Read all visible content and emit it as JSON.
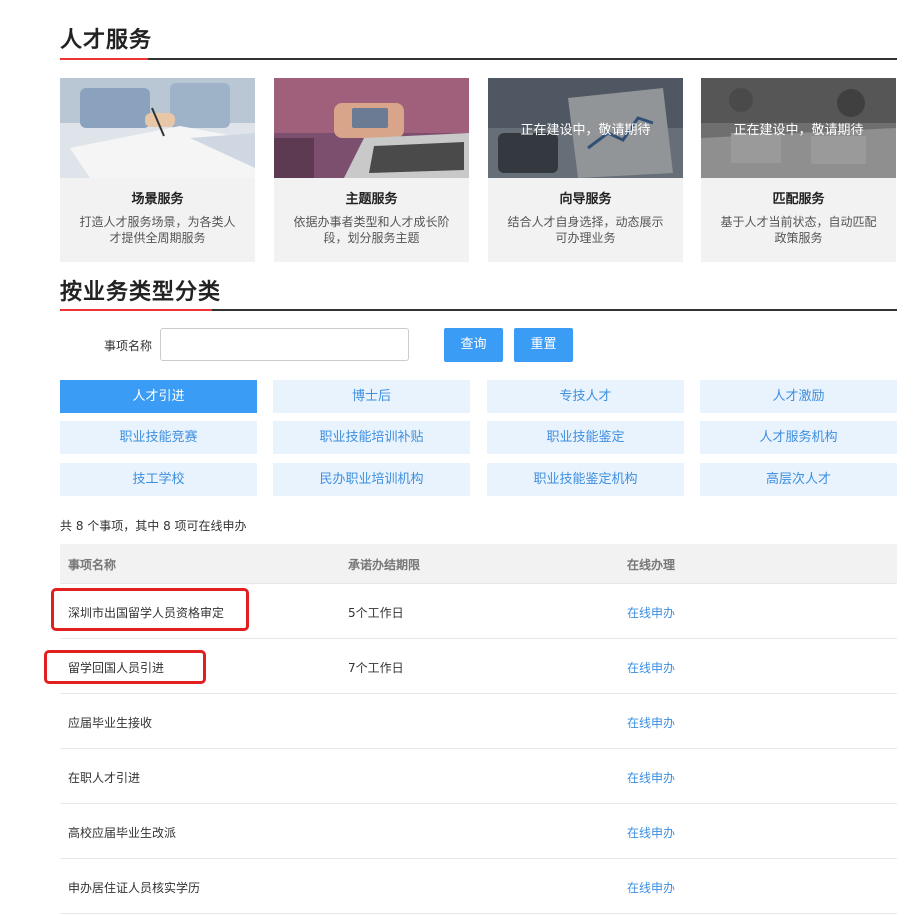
{
  "section1_title": "人才服务",
  "cards": [
    {
      "name": "场景服务",
      "desc": "打造人才服务场景，为各类人才提供全周期服务",
      "overlay": ""
    },
    {
      "name": "主题服务",
      "desc": "依据办事者类型和人才成长阶段，划分服务主题",
      "overlay": ""
    },
    {
      "name": "向导服务",
      "desc": "结合人才自身选择，动态展示可办理业务",
      "overlay": "正在建设中，敬请期待"
    },
    {
      "name": "匹配服务",
      "desc": "基于人才当前状态，自动匹配政策服务",
      "overlay": "正在建设中，敬请期待"
    }
  ],
  "section2_title": "按业务类型分类",
  "search": {
    "label": "事项名称",
    "value": "",
    "placeholder": ""
  },
  "buttons": {
    "query": "查询",
    "reset": "重置"
  },
  "categories": [
    "人才引进",
    "博士后",
    "专技人才",
    "人才激励",
    "职业技能竞赛",
    "职业技能培训补贴",
    "职业技能鉴定",
    "人才服务机构",
    "技工学校",
    "民办职业培训机构",
    "职业技能鉴定机构",
    "高层次人才"
  ],
  "active_category": "人才引进",
  "summary": "共 8 个事项，其中 8 项可在线申办",
  "table": {
    "headers": [
      "事项名称",
      "承诺办结期限",
      "在线办理"
    ],
    "rows": [
      {
        "name": "深圳市出国留学人员资格审定",
        "deadline": "5个工作日",
        "action": "在线申办"
      },
      {
        "name": "留学回国人员引进",
        "deadline": "7个工作日",
        "action": "在线申办"
      },
      {
        "name": "应届毕业生接收",
        "deadline": "",
        "action": "在线申办"
      },
      {
        "name": "在职人才引进",
        "deadline": "",
        "action": "在线申办"
      },
      {
        "name": "高校应届毕业生改派",
        "deadline": "",
        "action": "在线申办"
      },
      {
        "name": "申办居住证人员核实学历",
        "deadline": "",
        "action": "在线申办"
      }
    ]
  },
  "colors": {
    "accent": "#3b9cf5",
    "highlight": "#e21f1f",
    "link": "#3d8fe0"
  }
}
